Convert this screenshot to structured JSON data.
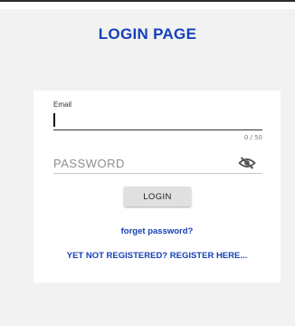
{
  "header": {
    "title": "LOGIN PAGE"
  },
  "form": {
    "email_label": "Email",
    "email_value": "",
    "email_counter": "0 / 50",
    "password_placeholder": "PASSWORD",
    "password_toggle_icon": "eye-off-icon",
    "login_label": "LOGIN"
  },
  "links": {
    "forget_password": "forget password?",
    "register": "YET NOT REGISTERED? REGISTER HERE..."
  },
  "colors": {
    "accent": "#1540b8",
    "background": "#f2f2f2",
    "card": "#ffffff",
    "button": "#e0e0e0"
  }
}
